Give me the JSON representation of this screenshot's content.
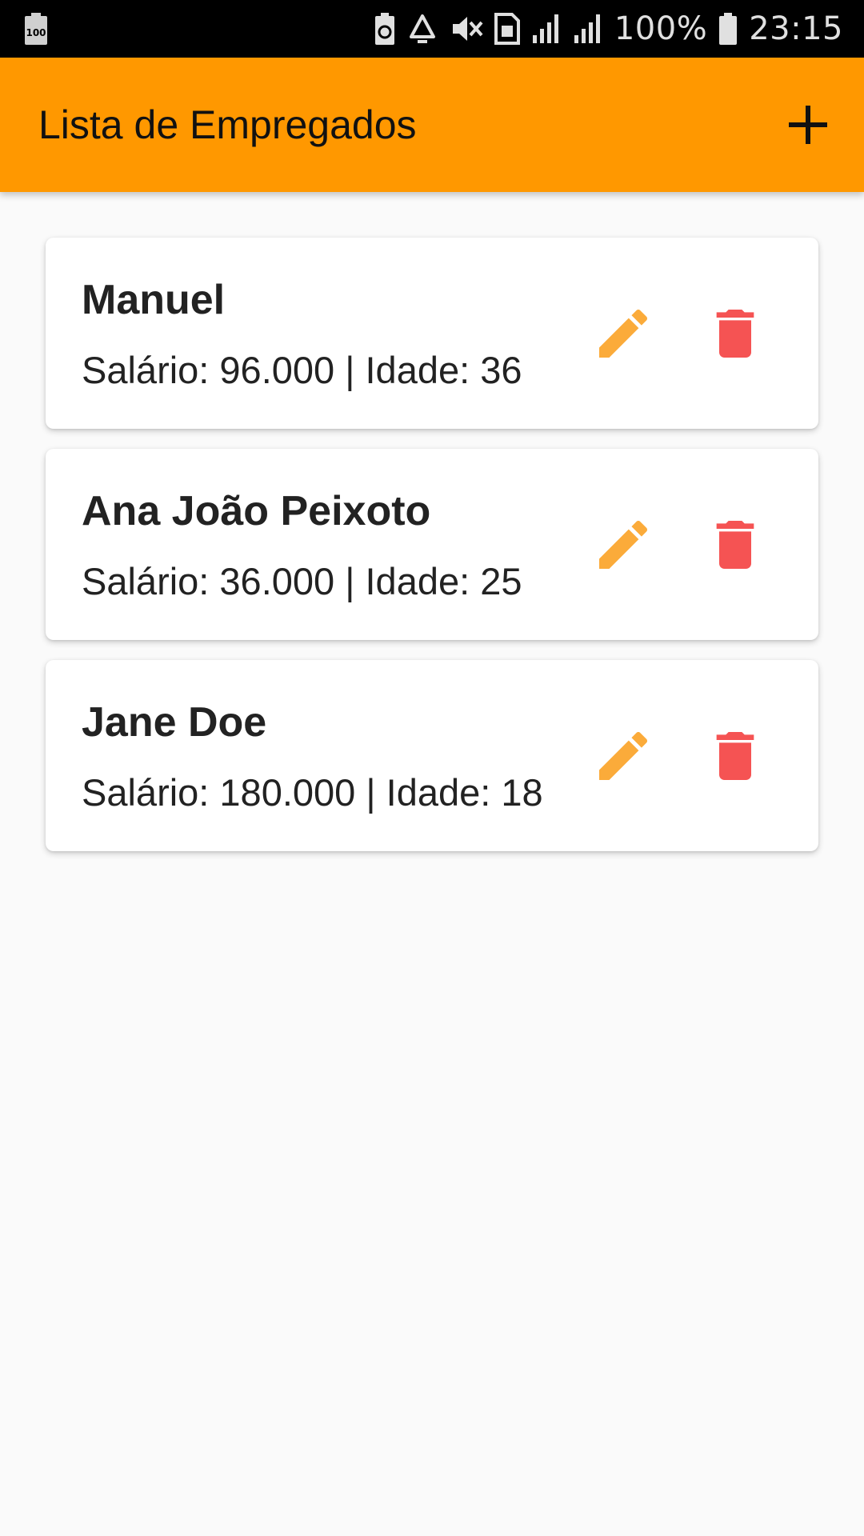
{
  "status_bar": {
    "battery_percent": "100%",
    "time": "23:15",
    "left_badge": "100",
    "icons": [
      "battery-saver-icon",
      "recycle-icon",
      "mute-icon",
      "sim-card-icon",
      "signal-icon",
      "signal-icon",
      "battery-icon"
    ]
  },
  "app_bar": {
    "title": "Lista de Empregados",
    "add_icon": "plus-icon",
    "color": "#ff9800"
  },
  "employees": [
    {
      "name": "Manuel",
      "details": "Salário: 96.000 | Idade: 36"
    },
    {
      "name": "Ana João Peixoto",
      "details": "Salário: 36.000 | Idade: 25"
    },
    {
      "name": "Jane Doe",
      "details": "Salário: 180.000 | Idade: 18"
    }
  ],
  "actions": {
    "edit_icon": "pencil-icon",
    "edit_color": "#fbab3a",
    "delete_icon": "trash-icon",
    "delete_color": "#f55353"
  }
}
